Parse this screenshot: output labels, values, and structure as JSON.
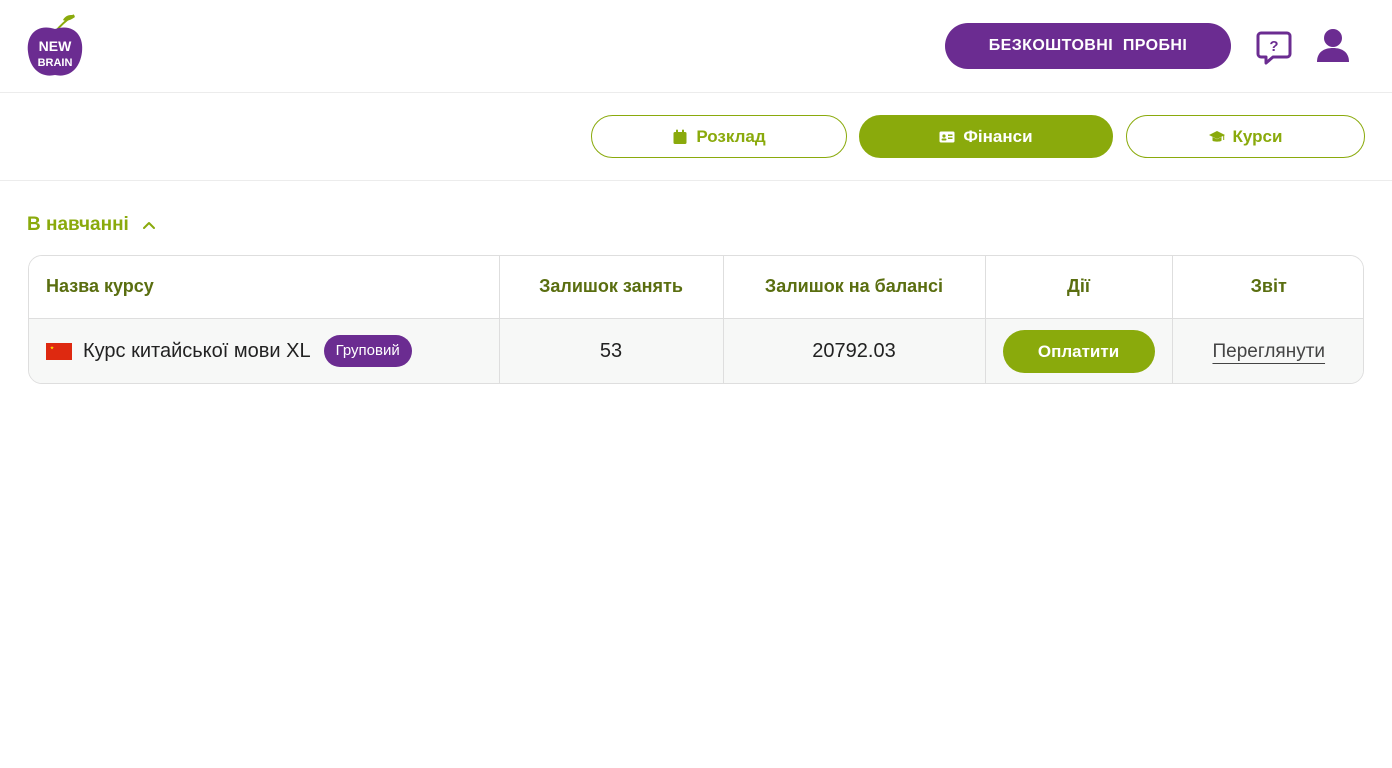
{
  "brand": {
    "logo_text_line1": "NEW",
    "logo_text_line2": "BRAIN"
  },
  "header": {
    "trial_button_label": "БЕЗКОШТОВНІ ПРОБНІ"
  },
  "tabs": [
    {
      "label": "Розклад",
      "icon": "calendar-icon",
      "active": false
    },
    {
      "label": "Фінанси",
      "icon": "id-card-icon",
      "active": true
    },
    {
      "label": "Курси",
      "icon": "graduation-cap-icon",
      "active": false
    }
  ],
  "section": {
    "title": "В навчанні"
  },
  "table": {
    "headers": [
      "Назва курсу",
      "Залишок занять",
      "Залишок на балансі",
      "Дії",
      "Звіт"
    ],
    "rows": [
      {
        "course": "Курс китайської мови XL",
        "badge": "Груповий",
        "lessons_left": "53",
        "balance": "20792.03",
        "action_label": "Оплатити",
        "report_label": "Переглянути"
      }
    ]
  },
  "colors": {
    "accent_green": "#8aaa0c",
    "brand_purple": "#6b2c91"
  }
}
